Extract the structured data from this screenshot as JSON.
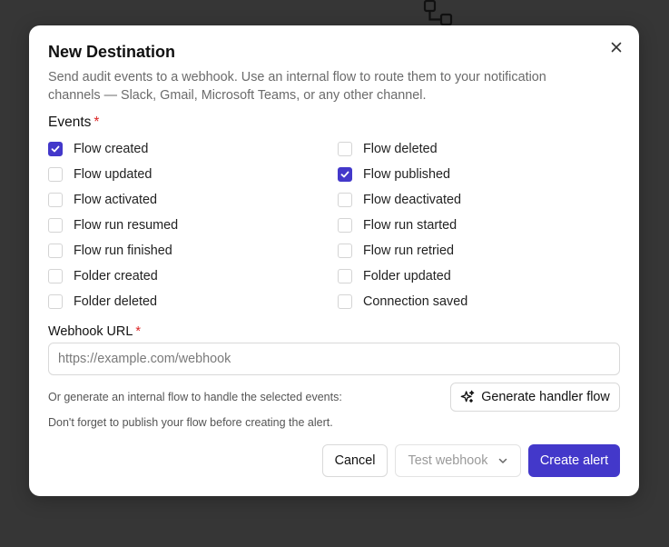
{
  "colors": {
    "accent": "#4338ca",
    "required": "#dc2626",
    "backdrop": "#363636"
  },
  "background": {
    "icon": "workflow-icon"
  },
  "dialog": {
    "title": "New Destination",
    "description": "Send audit events to a webhook. Use an internal flow to route them to your notification channels — Slack, Gmail, Microsoft Teams, or any other channel.",
    "close_icon": "close-icon"
  },
  "events": {
    "label": "Events",
    "required_mark": "*",
    "items": [
      {
        "label": "Flow created",
        "checked": true
      },
      {
        "label": "Flow deleted",
        "checked": false
      },
      {
        "label": "Flow updated",
        "checked": false
      },
      {
        "label": "Flow published",
        "checked": true
      },
      {
        "label": "Flow activated",
        "checked": false
      },
      {
        "label": "Flow deactivated",
        "checked": false
      },
      {
        "label": "Flow run resumed",
        "checked": false
      },
      {
        "label": "Flow run started",
        "checked": false
      },
      {
        "label": "Flow run finished",
        "checked": false
      },
      {
        "label": "Flow run retried",
        "checked": false
      },
      {
        "label": "Folder created",
        "checked": false
      },
      {
        "label": "Folder updated",
        "checked": false
      },
      {
        "label": "Folder deleted",
        "checked": false
      },
      {
        "label": "Connection saved",
        "checked": false
      }
    ]
  },
  "webhook": {
    "label": "Webhook URL",
    "required_mark": "*",
    "value": "",
    "placeholder": "https://example.com/webhook"
  },
  "generate": {
    "hint": "Or generate an internal flow to handle the selected events:",
    "button_label": "Generate handler flow",
    "button_icon": "sparkles-icon"
  },
  "publish_hint": "Don't forget to publish your flow before creating the alert.",
  "footer": {
    "cancel_label": "Cancel",
    "test_label": "Test webhook",
    "test_icon": "chevron-down-icon",
    "create_label": "Create alert"
  }
}
